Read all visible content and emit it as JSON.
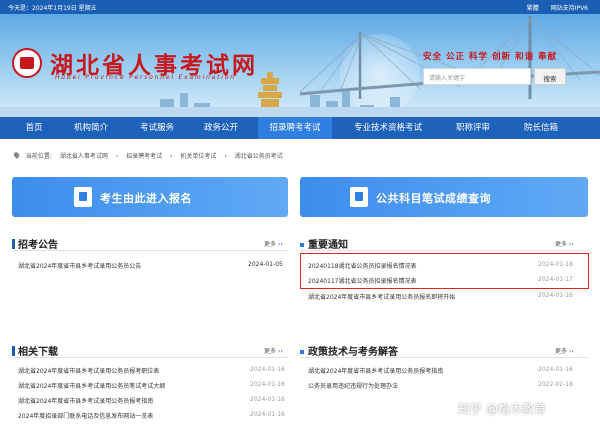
{
  "topbar": {
    "date": "今天是：2024年1月19日 星期五",
    "links": [
      "繁體",
      "网站支持IPV6"
    ]
  },
  "header": {
    "logo_cn": "湖北省人事考试网",
    "logo_en": "Hubei Province Personnel Examination",
    "slogan": [
      "安全",
      "公正",
      "科学",
      "创新",
      "和谐",
      "奉献"
    ],
    "search_placeholder": "请输入关键字",
    "search_button": "搜索"
  },
  "nav": {
    "items": [
      "首页",
      "机构简介",
      "考试服务",
      "政务公开",
      "招录聘考考试",
      "专业技术资格考试",
      "职称评审",
      "院长信箱"
    ],
    "active_index": 4
  },
  "breadcrumb": [
    "当前位置:",
    "湖北省人事考试网",
    "招录聘考考试",
    "机关单位考试",
    "湖北省公务员考试"
  ],
  "buttons": {
    "register": "考生由此进入报名",
    "scores": "公共科目笔试成绩查询"
  },
  "sections": {
    "recruit": {
      "title": "招考公告",
      "more": "更多",
      "items": [
        {
          "text": "湖北省2024年度省市县乡考试录用公务员公告",
          "date": "2024-01-05"
        }
      ]
    },
    "notice": {
      "title": "重要通知",
      "more": "更多",
      "items": [
        {
          "text": "20240118湖北省公务员招录报名情况表",
          "date": "2024-01-18"
        },
        {
          "text": "20240117湖北省公务员招录报名情况表",
          "date": "2024-01-17"
        },
        {
          "text": "湖北省2024年度省市县乡考试录用公务员报名即将开始",
          "date": "2024-01-16"
        }
      ]
    },
    "downloads": {
      "title": "相关下载",
      "more": "更多",
      "items": [
        {
          "text": "湖北省2024年度省市县乡考试录用公务员报考职位表",
          "date": "2024-01-16"
        },
        {
          "text": "湖北省2024年度省市县乡考试录用公务员笔试考试大纲",
          "date": "2024-01-16"
        },
        {
          "text": "湖北省2024年度省市县乡考试录用公务员报考指南",
          "date": "2024-01-16"
        },
        {
          "text": "2024年度招录部门联系电话及信息发布网站一览表",
          "date": "2024-01-16"
        }
      ]
    },
    "faq": {
      "title": "政策技术与考务解答",
      "more": "更多",
      "items": [
        {
          "text": "湖北省2024年度省市县乡考试录用公务员报考指南",
          "date": "2024-01-16"
        },
        {
          "text": "公务员录用违纪违规行为处理办法",
          "date": "2022-02-18"
        }
      ]
    }
  },
  "watermark": "知乎 @格木教育",
  "colors": {
    "brand": "#1a5fb4",
    "logo_red": "#c8161d",
    "highlight": "#e1261c"
  }
}
